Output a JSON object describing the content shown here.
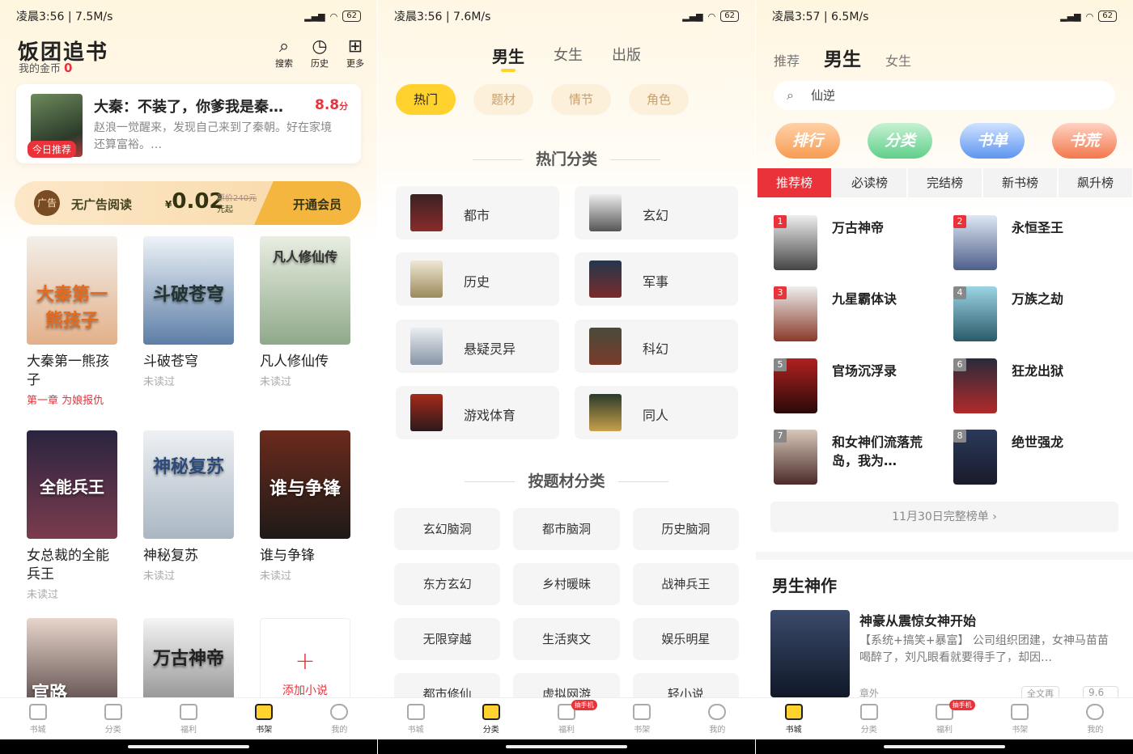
{
  "panels": [
    {
      "status": {
        "time": "凌晨3:56 | 7.5M/s",
        "battery": "62"
      }
    },
    {
      "status": {
        "time": "凌晨3:56 | 7.6M/s",
        "battery": "62"
      }
    },
    {
      "status": {
        "time": "凌晨3:57 | 6.5M/s",
        "battery": "62"
      }
    }
  ],
  "shelf": {
    "app_title": "饭团追书",
    "coins_label": "我的金币",
    "coins_value": "0",
    "top_buttons": [
      "搜索",
      "历史",
      "更多"
    ],
    "recommend": {
      "title": "大秦：不装了，你爹我是秦…",
      "score": "8.8",
      "score_unit": "分",
      "desc": "赵浪一觉醒来，发现自己来到了秦朝。好在家境还算富裕。…",
      "badge": "今日推荐"
    },
    "vip": {
      "icon_text": "广告",
      "text": "无广告阅读",
      "currency": "¥",
      "price": "0.02",
      "price_unit": "元起",
      "orig": "原价240元",
      "button": "开通会员"
    },
    "books": [
      {
        "title": "大秦第一熊孩子",
        "status": "第一章 为娘报仇",
        "cover_text": "大秦第一熊孩子"
      },
      {
        "title": "斗破苍穹",
        "status": "未读过",
        "cover_text": "斗破苍穹"
      },
      {
        "title": "凡人修仙传",
        "status": "未读过",
        "cover_text": "凡人修仙传"
      },
      {
        "title": "女总裁的全能兵王",
        "status": "未读过",
        "cover_text": "全能兵王"
      },
      {
        "title": "神秘复苏",
        "status": "未读过",
        "cover_text": "神秘复苏"
      },
      {
        "title": "谁与争锋",
        "status": "未读过",
        "cover_text": "谁与争锋"
      },
      {
        "title": "",
        "status": "",
        "cover_text": "官路"
      },
      {
        "title": "",
        "status": "",
        "cover_text": "万古神帝"
      }
    ],
    "add_book": "添加小说"
  },
  "category": {
    "tabs": [
      "男生",
      "女生",
      "出版"
    ],
    "pills": [
      "热门",
      "题材",
      "情节",
      "角色"
    ],
    "hot_title": "热门分类",
    "hot": [
      "都市",
      "玄幻",
      "历史",
      "军事",
      "悬疑灵异",
      "科幻",
      "游戏体育",
      "同人"
    ],
    "topic_title": "按题材分类",
    "topics": [
      "玄幻脑洞",
      "都市脑洞",
      "历史脑洞",
      "东方玄幻",
      "乡村暖昧",
      "战神兵王",
      "无限穿越",
      "生活爽文",
      "娱乐明星",
      "都市修仙",
      "虚拟网游",
      "轻小说"
    ]
  },
  "store": {
    "nav": [
      "推荐",
      "男生",
      "女生"
    ],
    "search_text": "仙逆",
    "quick": [
      "排行",
      "分类",
      "书单",
      "书荒"
    ],
    "rank_tabs": [
      "推荐榜",
      "必读榜",
      "完结榜",
      "新书榜",
      "飙升榜"
    ],
    "ranks": [
      {
        "n": "1",
        "title": "万古神帝"
      },
      {
        "n": "2",
        "title": "永恒圣王"
      },
      {
        "n": "3",
        "title": "九星霸体诀"
      },
      {
        "n": "4",
        "title": "万族之劫"
      },
      {
        "n": "5",
        "title": "官场沉浮录"
      },
      {
        "n": "6",
        "title": "狂龙出狱"
      },
      {
        "n": "7",
        "title": "和女神们流落荒岛，我为…"
      },
      {
        "n": "8",
        "title": "绝世强龙"
      }
    ],
    "full_rank": "11月30日完整榜单 ›",
    "section": "男生神作",
    "featured": {
      "title": "神豪从震惊女神开始",
      "desc": "【系统+搞笑+暴富】 公司组织团建，女神马苗苗喝醉了，刘凡眼看就要得手了，却因…",
      "extra": "章外",
      "tag": "全文再",
      "score": "9.6分"
    }
  },
  "tabbar": [
    "书城",
    "分类",
    "福利",
    "书架",
    "我的"
  ],
  "tabbar_badge": "抽手机",
  "colors": {
    "accent": "#ffd22e",
    "red": "#e9323a"
  }
}
